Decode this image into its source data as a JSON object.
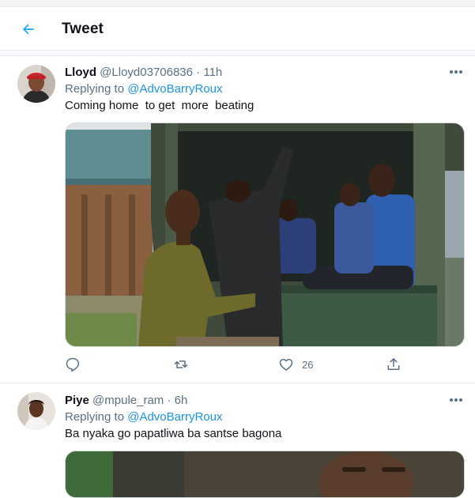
{
  "header": {
    "title": "Tweet",
    "back_icon": "arrow-left-icon",
    "accent": "#1da1f2"
  },
  "tweets": [
    {
      "name": "Lloyd",
      "handle": "@Lloyd03706836",
      "separator": "·",
      "time": "11h",
      "replying_label": "Replying to",
      "replying_to": "@AdvoBarryRoux",
      "text": "Coming home  to get  more  beating",
      "actions": {
        "reply_count": "",
        "retweet_count": "",
        "like_count": "26"
      }
    },
    {
      "name": "Piye",
      "handle": "@mpule_ram",
      "separator": "·",
      "time": "6h",
      "replying_label": "Replying to",
      "replying_to": "@AdvoBarryRoux",
      "text": "Ba nyaka go papatliwa ba santse bagona"
    }
  ],
  "colors": {
    "link": "#1b95e0",
    "secondary": "#5b7083",
    "divider": "#e6ecf0"
  }
}
